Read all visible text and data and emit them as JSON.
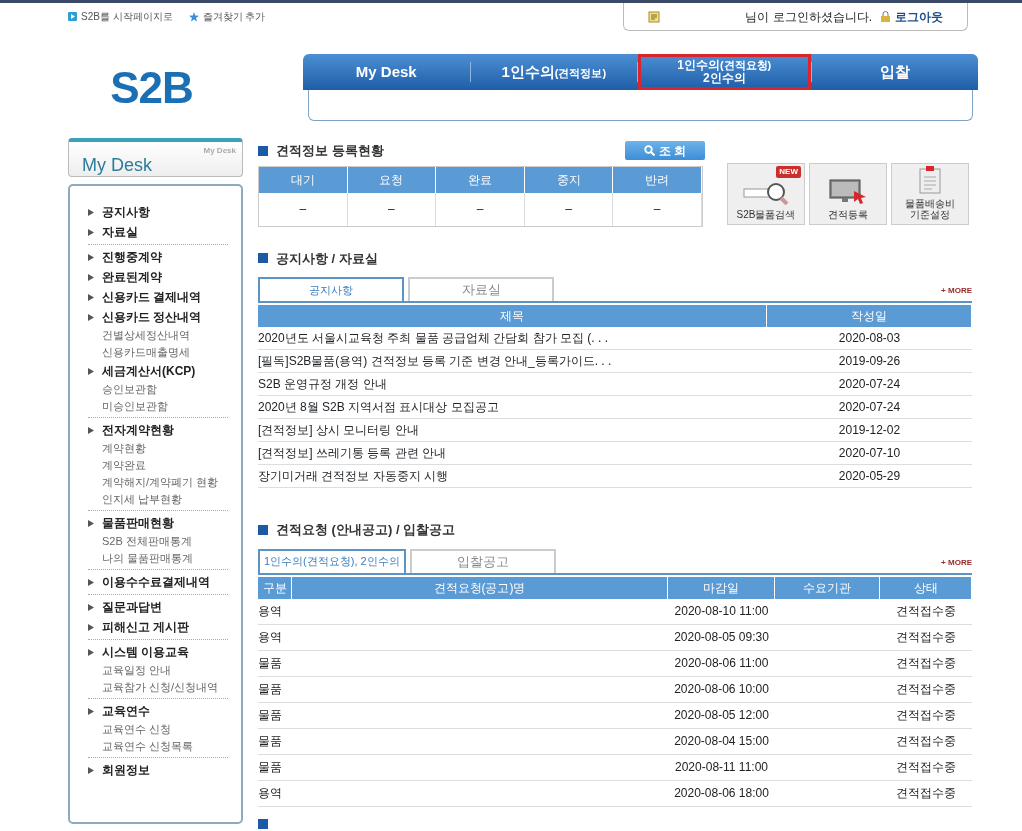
{
  "top_links": [
    {
      "label": "S2B를 시작페이지로",
      "kind": "play"
    },
    {
      "label": "즐겨찾기 추가",
      "kind": "star"
    }
  ],
  "login_box": {
    "message": "님이 로그인하셨습니다.",
    "logout": "로그아웃"
  },
  "logo": "S2B",
  "nav": {
    "items": [
      {
        "label": "My Desk",
        "highlighted": false
      },
      {
        "label": "1인수의",
        "note": "(견적정보)",
        "highlighted": false
      },
      {
        "label": "1인수의",
        "note": "(견적요청)",
        "line2": "2인수의",
        "highlighted": true
      },
      {
        "label": "입찰",
        "highlighted": false
      }
    ]
  },
  "sidebar": {
    "title": "My Desk",
    "caption": "My Desk",
    "groups": [
      {
        "items": [
          {
            "label": "공지사항"
          },
          {
            "label": "자료실"
          }
        ]
      },
      {
        "items": [
          {
            "label": "진행중계약"
          },
          {
            "label": "완료된계약"
          },
          {
            "label": "신용카드 결제내역"
          },
          {
            "label": "신용카드 정산내역",
            "children": [
              {
                "label": "건별상세정산내역"
              },
              {
                "label": "신용카드매출명세"
              }
            ]
          },
          {
            "label": "세금계산서(KCP)",
            "children": [
              {
                "label": "승인보관함"
              },
              {
                "label": "미승인보관함"
              }
            ]
          }
        ]
      },
      {
        "items": [
          {
            "label": "전자계약현황",
            "children": [
              {
                "label": "계약현황"
              },
              {
                "label": "계약완료"
              },
              {
                "label": "계약해지/계약폐기 현황"
              },
              {
                "label": "인지세 납부현황"
              }
            ]
          }
        ]
      },
      {
        "items": [
          {
            "label": "물품판매현황",
            "children": [
              {
                "label": "S2B 전체판매통계"
              },
              {
                "label": "나의 물품판매통계"
              }
            ]
          }
        ]
      },
      {
        "items": [
          {
            "label": "이용수수료결제내역"
          }
        ]
      },
      {
        "items": [
          {
            "label": "질문과답변"
          },
          {
            "label": "피해신고 게시판"
          }
        ]
      },
      {
        "items": [
          {
            "label": "시스템 이용교육",
            "children": [
              {
                "label": "교육일정 안내"
              },
              {
                "label": "교육참가 신청/신청내역"
              }
            ]
          }
        ]
      },
      {
        "items": [
          {
            "label": "교육연수",
            "children": [
              {
                "label": "교육연수 신청"
              },
              {
                "label": "교육연수 신청목록"
              }
            ]
          }
        ]
      },
      {
        "items": [
          {
            "label": "회원정보"
          }
        ]
      }
    ]
  },
  "quote_status": {
    "title": "견적정보 등록현황",
    "search_button": "조 회",
    "columns": [
      "대기",
      "요청",
      "완료",
      "중지",
      "반려"
    ],
    "values": [
      "–",
      "–",
      "–",
      "–",
      "–"
    ]
  },
  "quick_links": [
    {
      "kind": "search",
      "lines": [
        "S2B물품검색"
      ],
      "badge": "NEW"
    },
    {
      "kind": "monitor",
      "lines": [
        "견적등록"
      ]
    },
    {
      "kind": "clipboard",
      "lines": [
        "물품배송비",
        "기준설정"
      ]
    }
  ],
  "notices": {
    "title": "공지사항 / 자료실",
    "more": "+ MORE",
    "tabs": [
      {
        "label": "공지사항",
        "selected": true
      },
      {
        "label": "자료실",
        "selected": false
      }
    ],
    "columns": [
      "제목",
      "작성일"
    ],
    "rows": [
      {
        "title": "2020년도 서울시교육청 주최 물품 공급업체 간담회 참가 모집 (. . .",
        "date": "2020-08-03"
      },
      {
        "title": "[필독]S2B물품(용역) 견적정보 등록 기준 변경 안내_등록가이드. . .",
        "date": "2019-09-26"
      },
      {
        "title": "S2B 운영규정 개정 안내",
        "date": "2020-07-24"
      },
      {
        "title": "2020년 8월 S2B 지역서점 표시대상 모집공고",
        "date": "2020-07-24"
      },
      {
        "title": "[견적정보] 상시 모니터링 안내",
        "date": "2019-12-02"
      },
      {
        "title": "[견적정보] 쓰레기통 등록 관련 안내",
        "date": "2020-07-10"
      },
      {
        "title": "장기미거래 견적정보 자동중지 시행",
        "date": "2020-05-29"
      }
    ]
  },
  "bids": {
    "title": "견적요청 (안내공고) / 입찰공고",
    "more": "+ MORE",
    "tabs": [
      {
        "label": "1인수의(견적요청), 2인수의",
        "selected": true
      },
      {
        "label": "입찰공고",
        "selected": false
      }
    ],
    "columns": [
      "구분",
      "견적요청(공고)명",
      "마감일",
      "수요기관",
      "상태"
    ],
    "rows": [
      {
        "type": "용역",
        "deadline": "2020-08-10 11:00",
        "status": "견적접수중"
      },
      {
        "type": "용역",
        "deadline": "2020-08-05 09:30",
        "status": "견적접수중"
      },
      {
        "type": "물품",
        "deadline": "2020-08-06 11:00",
        "status": "견적접수중"
      },
      {
        "type": "물품",
        "deadline": "2020-08-06 10:00",
        "status": "견적접수중"
      },
      {
        "type": "물품",
        "deadline": "2020-08-05 12:00",
        "status": "견적접수중"
      },
      {
        "type": "물품",
        "deadline": "2020-08-04 15:00",
        "status": "견적접수중"
      },
      {
        "type": "물품",
        "deadline": "2020-08-11 11:00",
        "status": "견적접수중"
      },
      {
        "type": "용역",
        "deadline": "2020-08-06 18:00",
        "status": "견적접수중"
      }
    ]
  }
}
